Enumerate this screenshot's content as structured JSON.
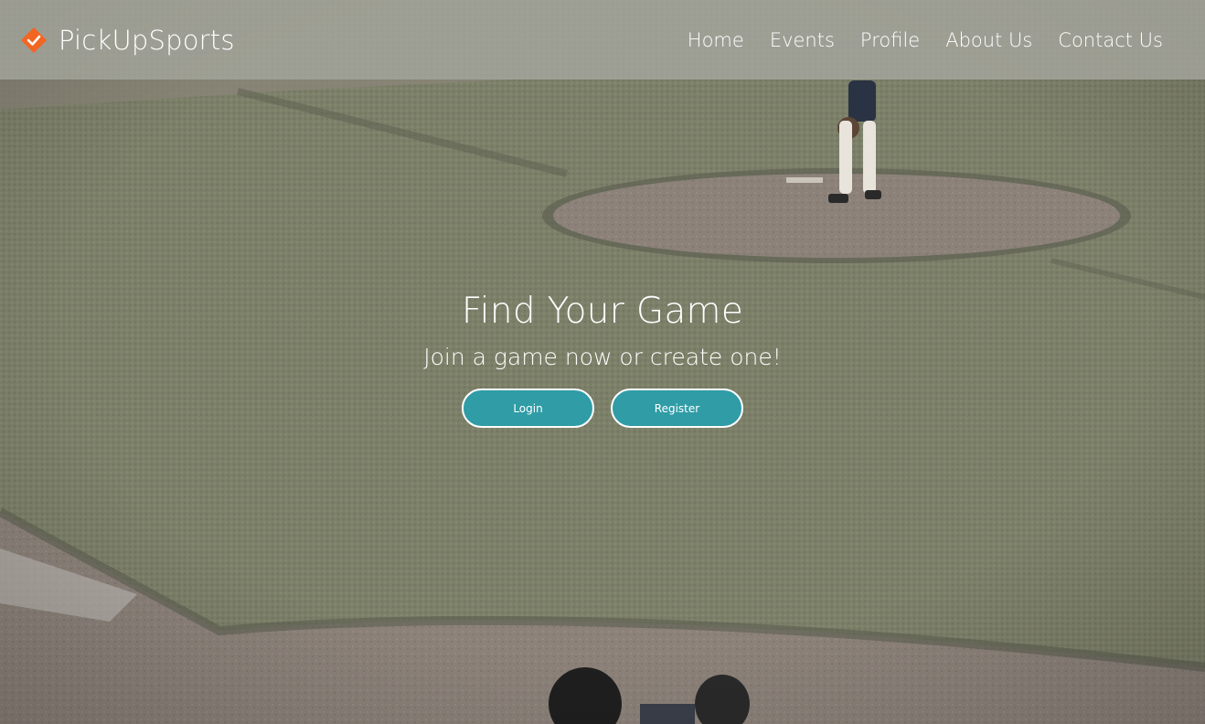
{
  "brand": {
    "name": "PickUpSports",
    "icon": "orange-diamond-checkmark-icon",
    "accent_color": "#f26522"
  },
  "nav": {
    "items": [
      {
        "label": "Home"
      },
      {
        "label": "Events"
      },
      {
        "label": "Profile"
      },
      {
        "label": "About Us"
      },
      {
        "label": "Contact Us"
      }
    ]
  },
  "hero": {
    "title": "Find Your Game",
    "subtitle": "Join a game now or create one!",
    "login_label": "Login",
    "register_label": "Register",
    "button_color": "#2f9ca6",
    "background": "baseball-field-photo"
  }
}
